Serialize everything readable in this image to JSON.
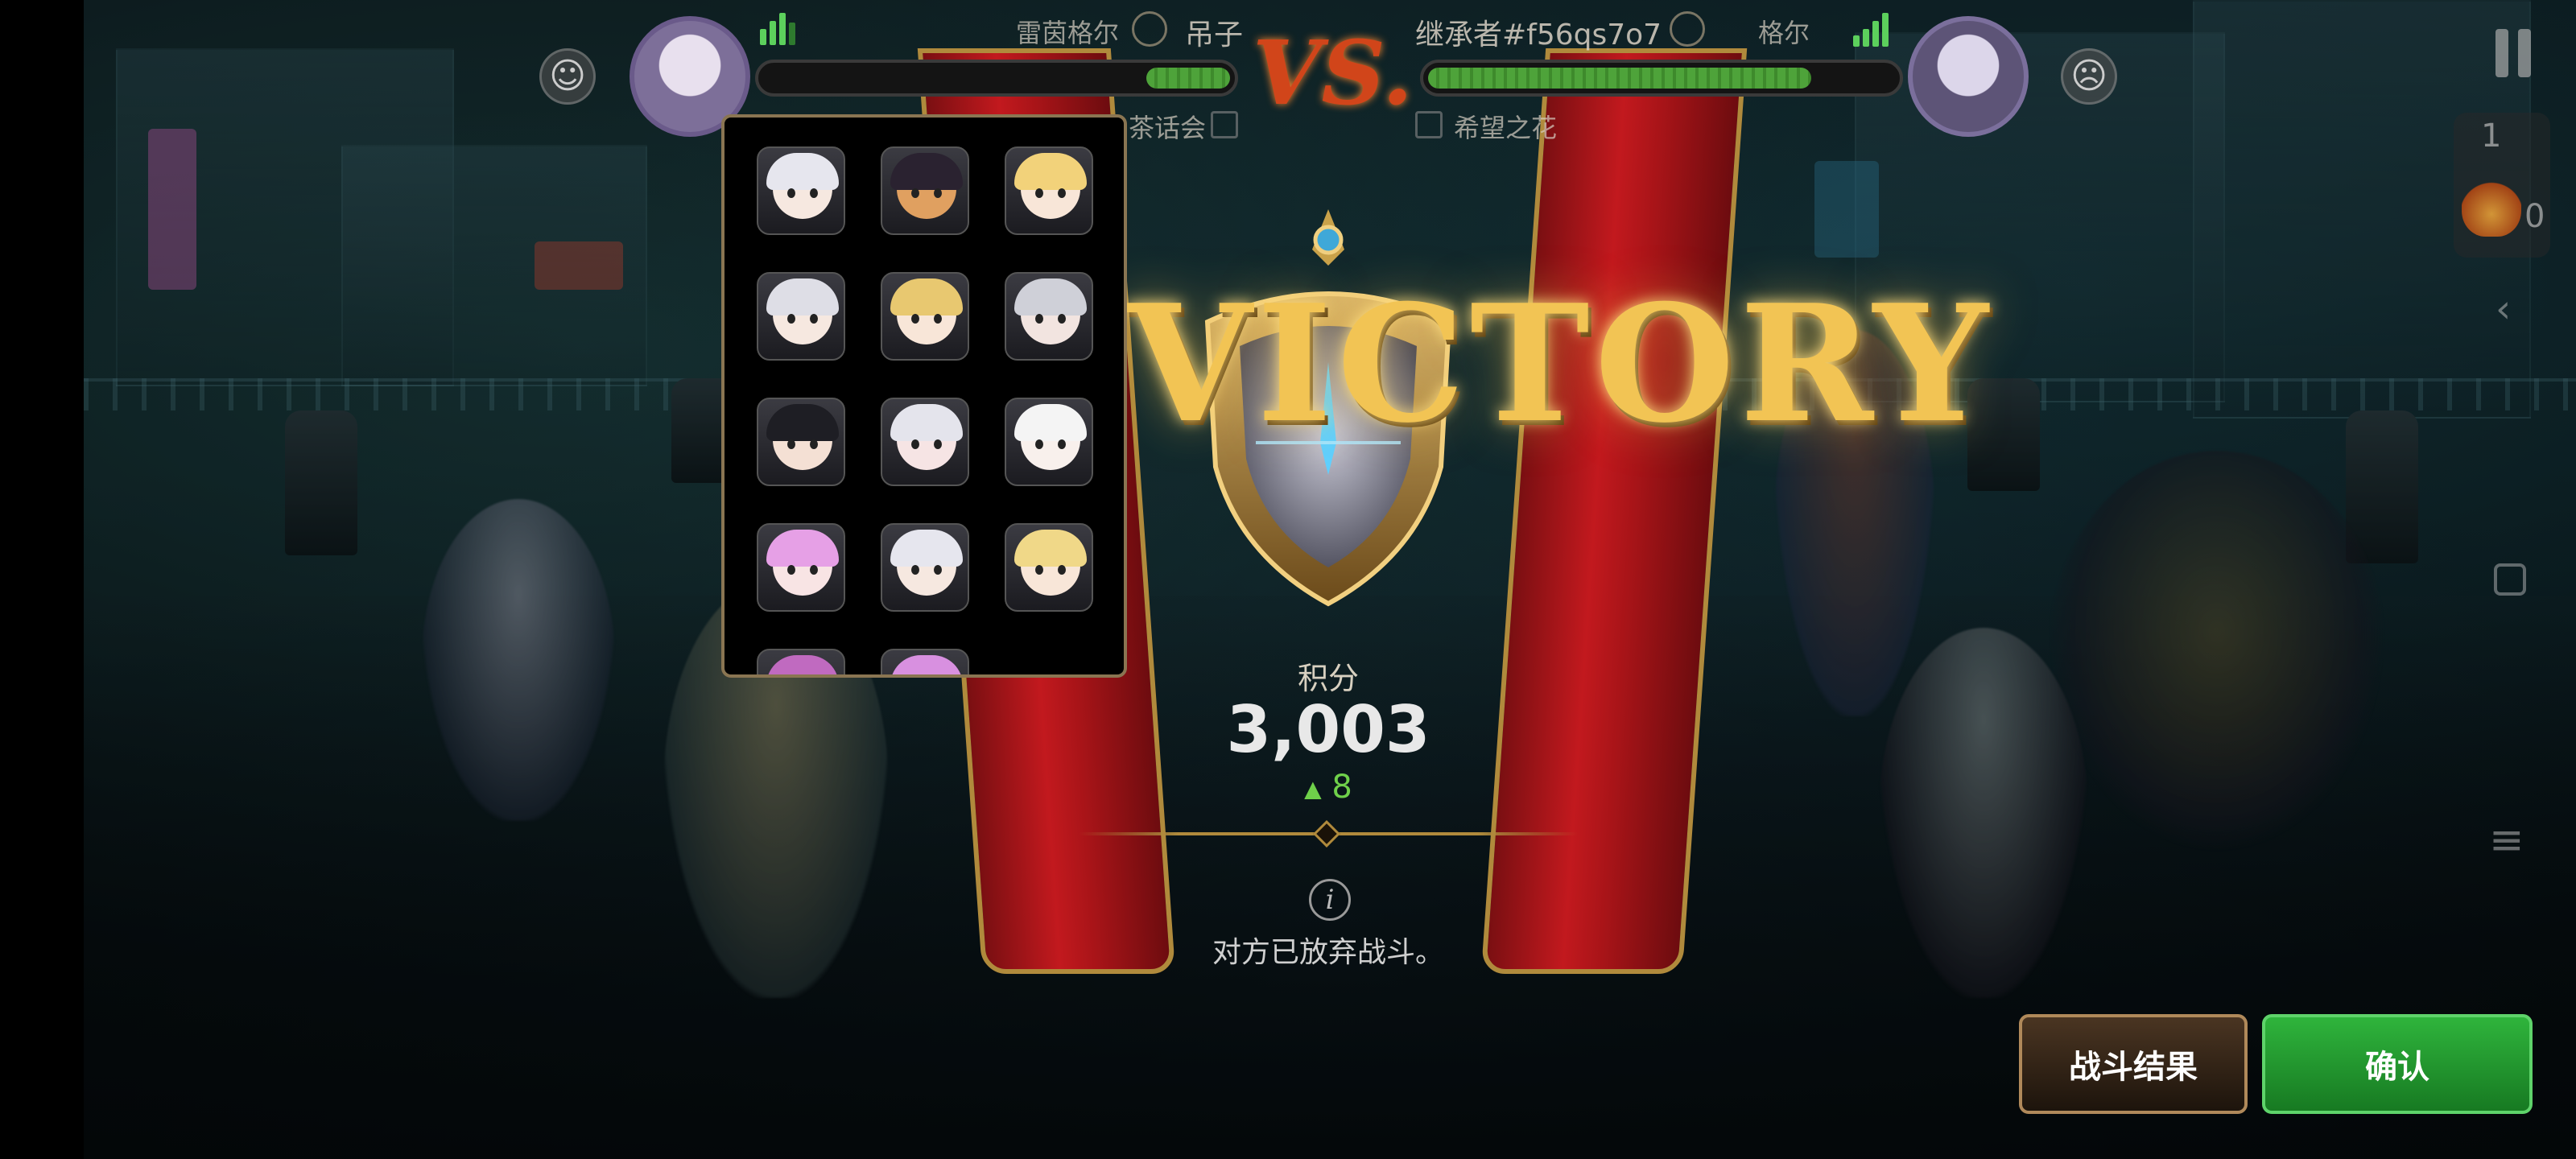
{
  "hud": {
    "left_player_title": "雷茵格尔",
    "left_player_name": "吊子",
    "left_guild": "茶话会",
    "vs_label": "VS.",
    "right_player_name": "继承者#f56qs7o7",
    "right_player_title": "格尔",
    "right_guild": "希望之花",
    "left_hp": 0.18,
    "right_hp": 0.82,
    "right_counter_top": "1",
    "right_counter_bottom": "0"
  },
  "result": {
    "headline": "VICTORY",
    "score_label": "积分",
    "score_value": "3,003",
    "score_delta": "8",
    "info_message": "对方已放弃战斗。"
  },
  "emote_panel": {
    "emotes": [
      {
        "name": "emote-1",
        "hair": "#e6e6ee",
        "face": "#f6e8e0"
      },
      {
        "name": "emote-2",
        "hair": "#2a2230",
        "face": "#e0a060"
      },
      {
        "name": "emote-3",
        "hair": "#f2d27a",
        "face": "#f8e6d8"
      },
      {
        "name": "emote-4",
        "hair": "#dedee6",
        "face": "#f6e8e0"
      },
      {
        "name": "emote-5",
        "hair": "#e8c870",
        "face": "#f8e6d8"
      },
      {
        "name": "emote-6",
        "hair": "#cfd0d8",
        "face": "#f2e4e0"
      },
      {
        "name": "emote-7",
        "hair": "#1e1e24",
        "face": "#f4e0d4"
      },
      {
        "name": "emote-8",
        "hair": "#e4e4ec",
        "face": "#f6e4e4"
      },
      {
        "name": "emote-9",
        "hair": "#f4f4f4",
        "face": "#f8f0ec"
      },
      {
        "name": "emote-10",
        "hair": "#e6a0e6",
        "face": "#f8e4e4"
      },
      {
        "name": "emote-11",
        "hair": "#e6e6ee",
        "face": "#f6e8e0"
      },
      {
        "name": "emote-12",
        "hair": "#f0d888",
        "face": "#f8e6d8"
      },
      {
        "name": "emote-13",
        "hair": "#c06ac0",
        "face": "#f8e4e4"
      },
      {
        "name": "emote-14",
        "hair": "#d890e0",
        "face": "#f8e4e4"
      }
    ]
  },
  "buttons": {
    "battle_result": "战斗结果",
    "confirm": "确认"
  },
  "icons": {
    "pause": "pause-icon",
    "emote": "emote-icon",
    "info": "info-icon",
    "fire": "fire-icon",
    "back": "chevron-left-icon",
    "home": "square-icon",
    "menu": "menu-icon"
  },
  "colors": {
    "gold": "#f2c454",
    "victory_red": "#c2191e",
    "confirm_green": "#2fb43c",
    "delta_green": "#6fd04a"
  }
}
